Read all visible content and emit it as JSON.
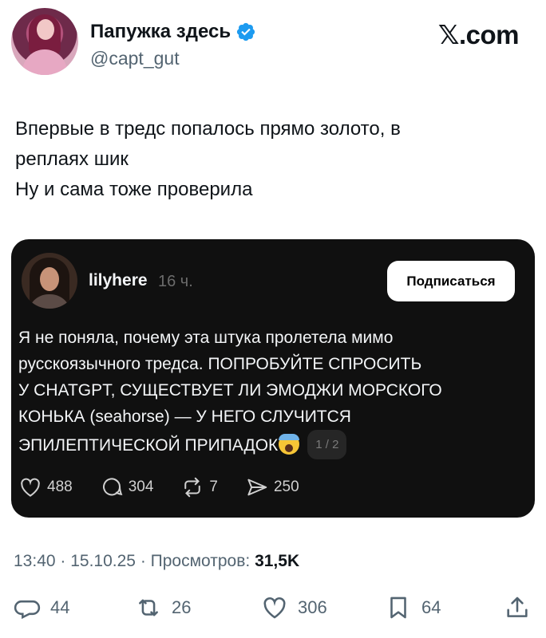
{
  "author": {
    "display_name": "Папужка здесь",
    "handle": "@capt_gut",
    "verified": true
  },
  "brand": {
    "logo_text": ".com",
    "logo_mark": "𝕏"
  },
  "tweet": {
    "lines": [
      "Впервые в тредс попалось прямо золото, в",
      "реплаях шик",
      "Ну и сама тоже проверила"
    ]
  },
  "embedded_post": {
    "username": "lilyhere",
    "time": "16 ч.",
    "subscribe_label": "Подписаться",
    "text_lines": [
      "Я не поняла, почему эта штука пролетела мимо",
      "русскоязычного тредса. ПОПРОБУЙТЕ СПРОСИТЬ",
      "У CHATGPT, СУЩЕСТВУЕТ ЛИ ЭМОДЖИ МОРСКОГО",
      "КОНЬКА (seahorse) — У НЕГО СЛУЧИТСЯ",
      "ЭПИЛЕПТИЧЕСКОЙ ПРИПАДОК"
    ],
    "pager": "1 / 2",
    "actions": {
      "likes": "488",
      "comments": "304",
      "reposts": "7",
      "shares": "250"
    }
  },
  "meta": {
    "time": "13:40",
    "date": "15.10.25",
    "views_label": "Просмотров:",
    "views": "31,5K",
    "sep": " · "
  },
  "actions": {
    "replies": "44",
    "retweets": "26",
    "likes": "306",
    "bookmarks": "64"
  },
  "colors": {
    "text": "#0f1419",
    "muted": "#536471",
    "verified": "#1d9bf0",
    "card_bg": "#101010"
  }
}
